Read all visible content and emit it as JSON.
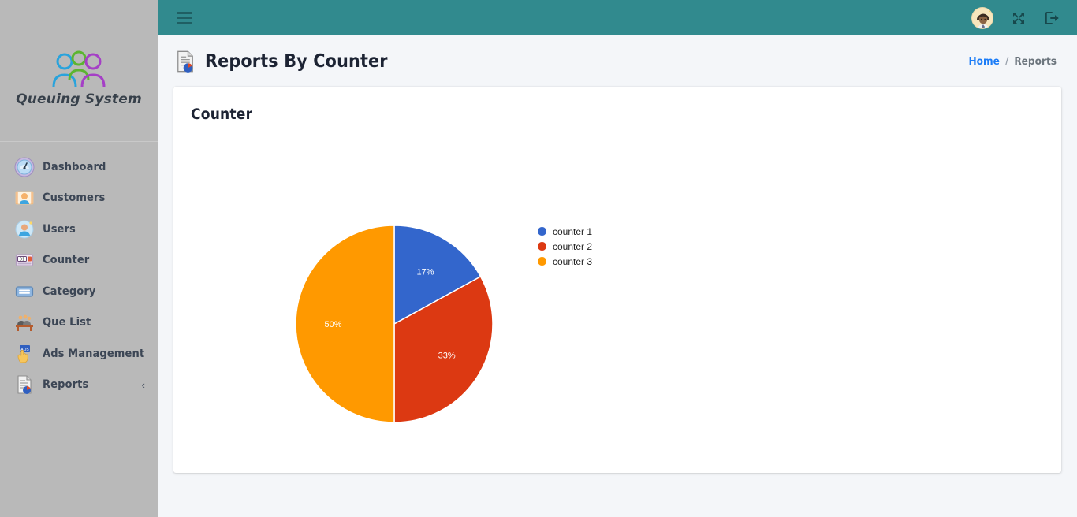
{
  "brand": {
    "name": "Queuing System",
    "logo_icon": "three-people-icon"
  },
  "sidebar": {
    "items": [
      {
        "label": "Dashboard",
        "icon": "gauge-icon",
        "chevron": ""
      },
      {
        "label": "Customers",
        "icon": "contact-card-icon",
        "chevron": ""
      },
      {
        "label": "Users",
        "icon": "user-circle-icon",
        "chevron": ""
      },
      {
        "label": "Counter",
        "icon": "counter-display-icon",
        "chevron": ""
      },
      {
        "label": "Category",
        "icon": "card-list-icon",
        "chevron": ""
      },
      {
        "label": "Que List",
        "icon": "queue-people-icon",
        "chevron": ""
      },
      {
        "label": "Ads Management",
        "icon": "hand-tap-ad-icon",
        "chevron": ""
      },
      {
        "label": "Reports",
        "icon": "report-chart-icon",
        "chevron": "‹"
      }
    ]
  },
  "topbar": {
    "menu_icon": "hamburger-icon",
    "avatar_icon": "user-avatar",
    "fullscreen_icon": "fullscreen-expand-icon",
    "logout_icon": "logout-icon"
  },
  "page": {
    "icon": "report-chart-icon",
    "title": "Reports By Counter",
    "breadcrumb": {
      "home": "Home",
      "separator": "/",
      "current": "Reports"
    }
  },
  "card": {
    "title": "Counter"
  },
  "chart_data": {
    "type": "pie",
    "title": "Counter",
    "categories": [
      "counter 1",
      "counter 2",
      "counter 3"
    ],
    "values": [
      17,
      33,
      50
    ],
    "labels": [
      "17%",
      "33%",
      "50%"
    ],
    "colors": [
      "#3366cc",
      "#dc3912",
      "#ff9900"
    ],
    "legend": "right",
    "start_angle_deg": 0,
    "direction": "clockwise",
    "slices": [
      {
        "name": "counter 1",
        "percent": 17,
        "label": "17%",
        "color": "#3366cc"
      },
      {
        "name": "counter 2",
        "percent": 33,
        "label": "33%",
        "color": "#dc3912"
      },
      {
        "name": "counter 3",
        "percent": 50,
        "label": "50%",
        "color": "#ff9900"
      }
    ]
  },
  "colors": {
    "header_teal": "#318a8e",
    "sidebar_gray": "#b9b9b9",
    "content_bg": "#f4f6f9",
    "link_blue": "#1b7cf7"
  }
}
